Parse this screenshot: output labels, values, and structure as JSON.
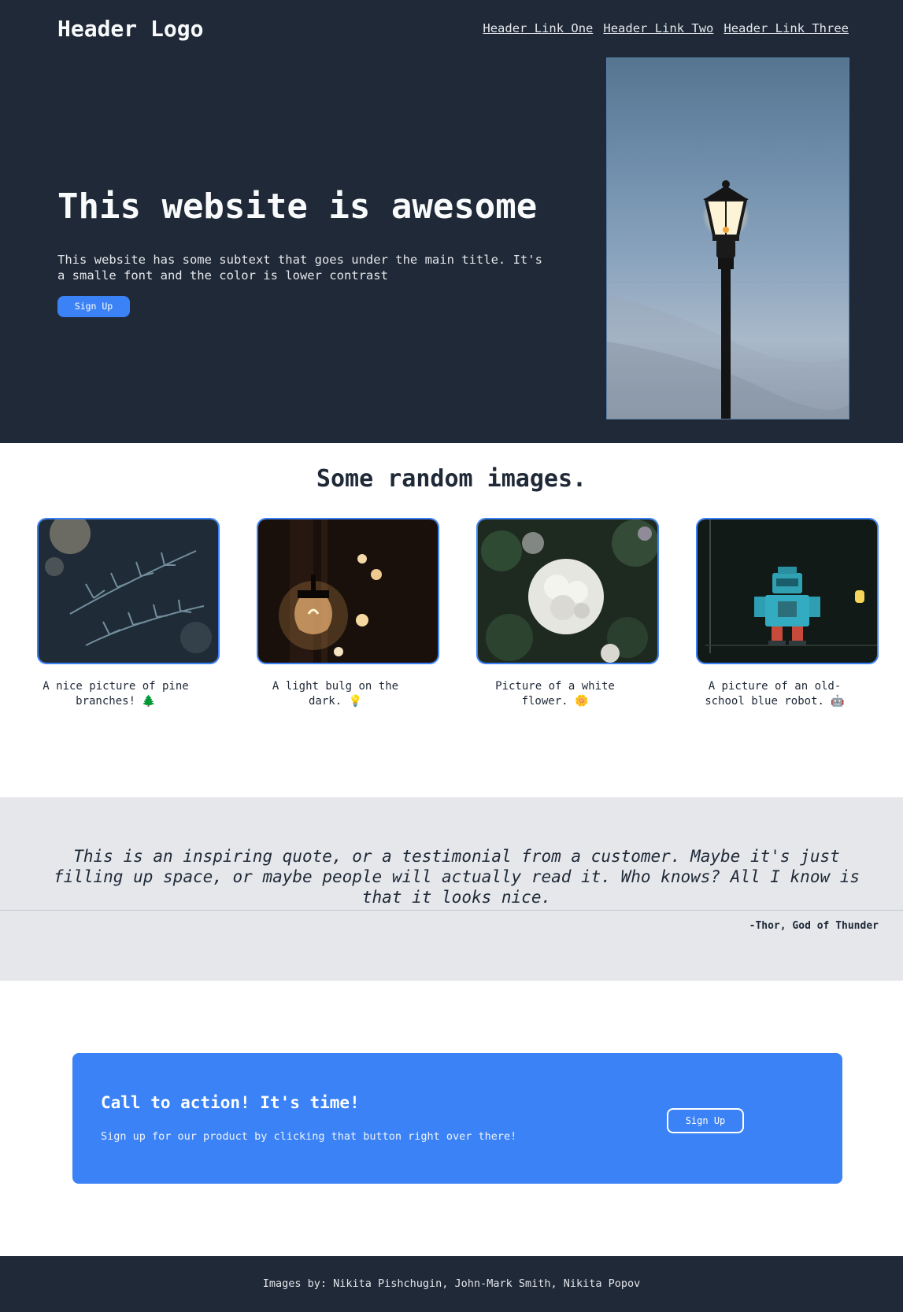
{
  "header": {
    "logo": "Header Logo",
    "links": [
      "Header Link One",
      "Header Link Two",
      "Header Link Three"
    ]
  },
  "hero": {
    "title": "This website is awesome",
    "subtitle": "This website has some subtext that goes under the main title. It's a smalle font and the color is lower contrast",
    "button": "Sign Up",
    "image": "street-lamp-photo"
  },
  "images_section": {
    "title": "Some random images.",
    "items": [
      {
        "caption": "A nice picture of pine branches! 🌲",
        "image": "pine-branches-photo"
      },
      {
        "caption": "A light bulg on the dark. 💡",
        "image": "light-bulb-photo"
      },
      {
        "caption": "Picture of a white flower. 🌼",
        "image": "white-flower-photo"
      },
      {
        "caption": "A picture of an old-school blue robot. 🤖",
        "image": "blue-robot-photo"
      }
    ]
  },
  "quote": {
    "text": "This is an inspiring quote, or a testimonial from a customer. Maybe it's just filling up space, or maybe people will actually read it. Who knows? All I know is that it looks nice.",
    "author": "-Thor, God of Thunder"
  },
  "cta": {
    "title": "Call to action! It's time!",
    "subtitle": "Sign up for our product by clicking that button right over there!",
    "button": "Sign Up"
  },
  "footer": {
    "credits": "Images by: Nikita Pishchugin, John-Mark Smith, Nikita Popov"
  },
  "colors": {
    "dark": "#1f2937",
    "accent": "#3b82f6",
    "quote_bg": "#e5e7eb"
  }
}
